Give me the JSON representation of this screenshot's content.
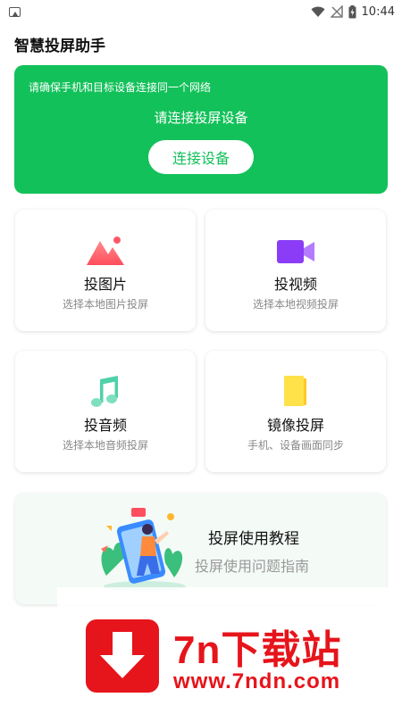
{
  "status_bar": {
    "time": "10:44"
  },
  "app_title": "智慧投屏助手",
  "banner": {
    "tip": "请确保手机和目标设备连接同一个网络",
    "status": "请连接投屏设备",
    "button_label": "连接设备",
    "bg_color": "#13c15a"
  },
  "cards": [
    {
      "title": "投图片",
      "subtitle": "选择本地图片投屏",
      "icon": "image-icon"
    },
    {
      "title": "投视频",
      "subtitle": "选择本地视频投屏",
      "icon": "video-camera-icon"
    },
    {
      "title": "投音频",
      "subtitle": "选择本地音频投屏",
      "icon": "music-note-icon"
    },
    {
      "title": "镜像投屏",
      "subtitle": "手机、设备画面同步",
      "icon": "mirror-icon"
    }
  ],
  "tutorial": {
    "title": "投屏使用教程",
    "subtitle": "投屏使用问题指南"
  },
  "watermark": {
    "name": "7n下载站",
    "url": "www.7ndn.com",
    "color": "#e6141b"
  }
}
